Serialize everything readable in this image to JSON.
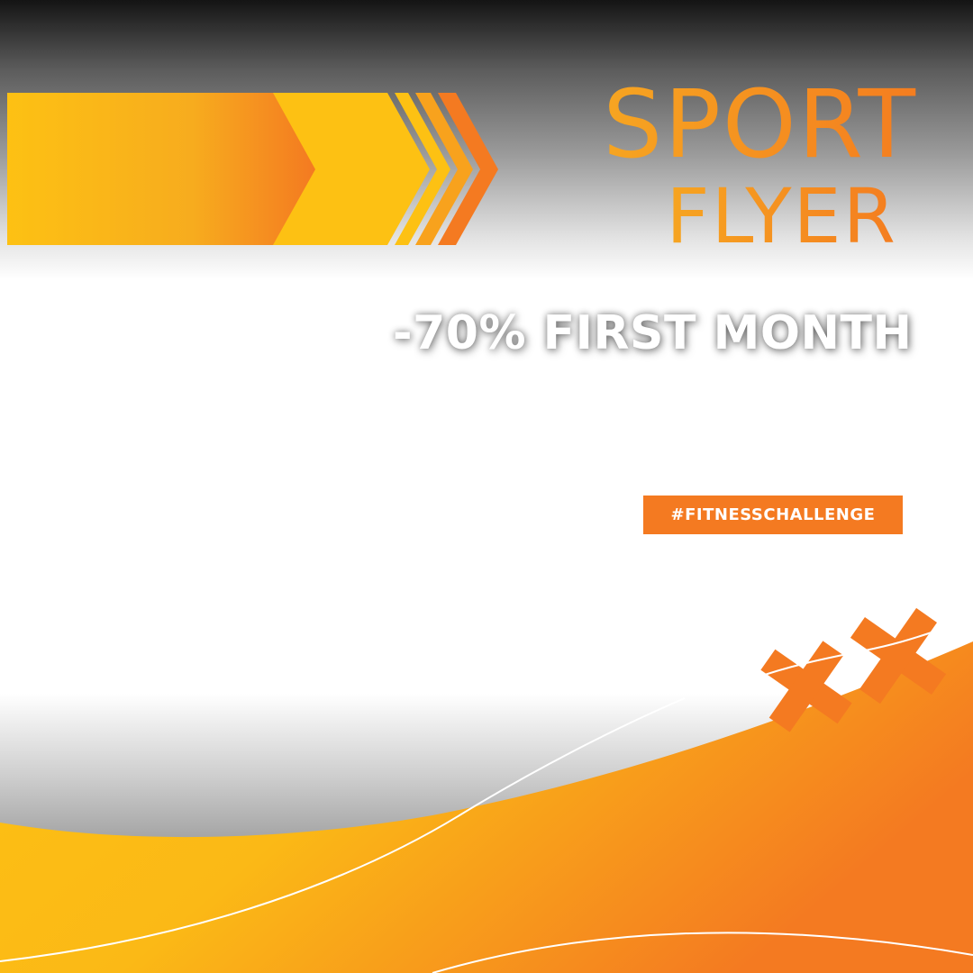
{
  "title": {
    "line1": "SPORT",
    "line2": "FLYER"
  },
  "promo": "-70% FIRST MONTH",
  "hashtag": "#FITNESSCHALLENGE",
  "colors": {
    "yellow": "#fdc113",
    "orange": "#f47a21",
    "dark_gray": "#141414"
  }
}
